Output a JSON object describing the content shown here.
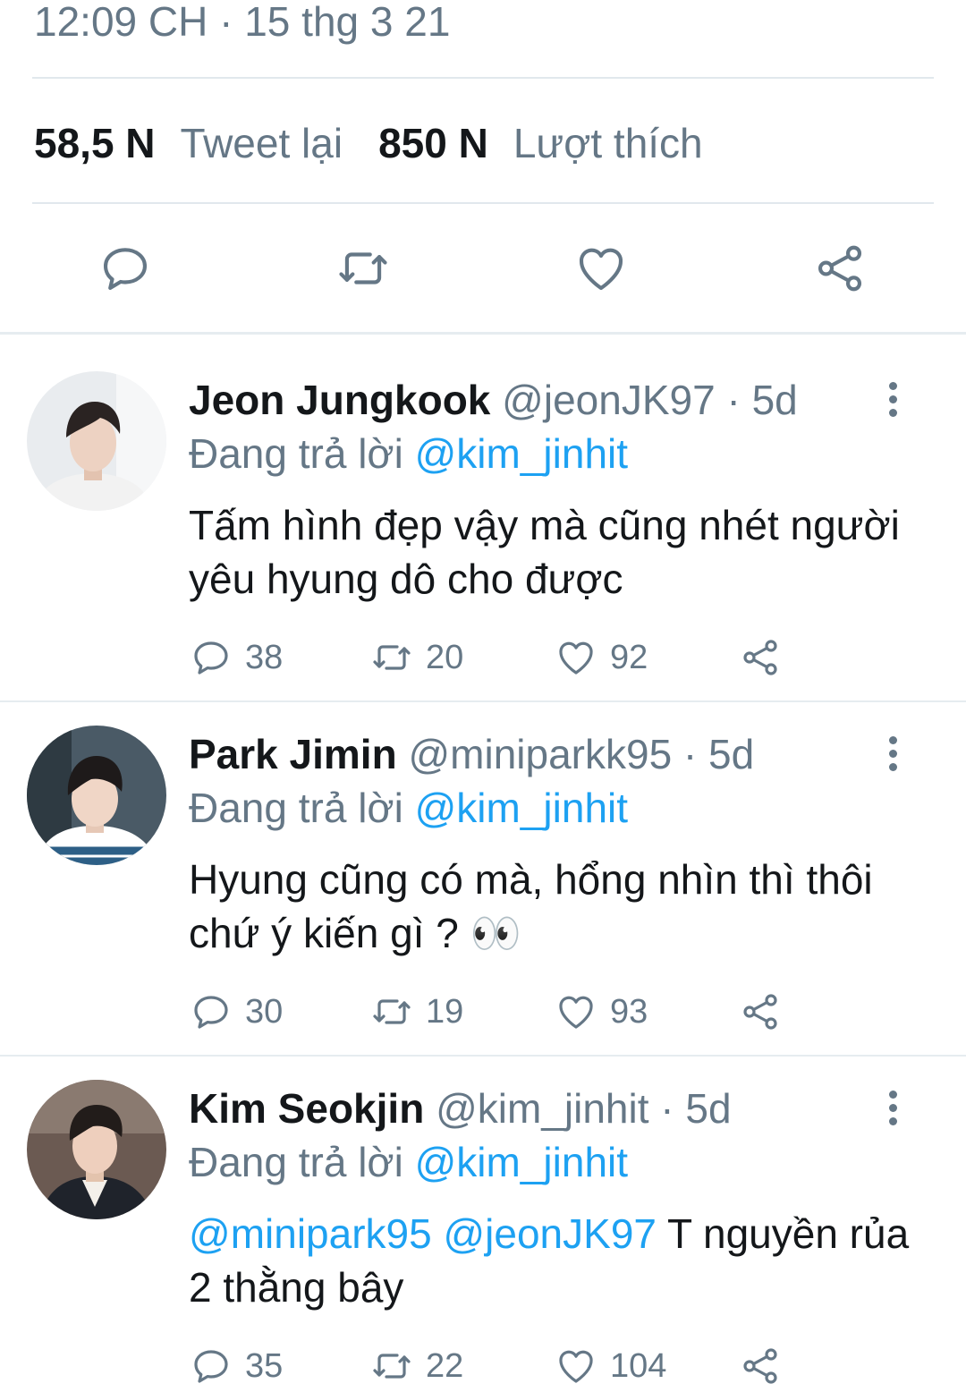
{
  "detail": {
    "timestamp": "12:09 CH · 15 thg 3 21",
    "retweets_count": "58,5 N",
    "retweets_label": "Tweet lại",
    "likes_count": "850 N",
    "likes_label": "Lượt thích"
  },
  "colors": {
    "accent": "#1da1f2",
    "secondary_text": "#657786",
    "divider": "#e1e8ed"
  },
  "replies": [
    {
      "name": "Jeon Jungkook",
      "handle": "@jeonJK97 · 5d",
      "replying_label": "Đang trả lời",
      "replying_to": "@kim_jinhit",
      "text_mentions": "",
      "text": "Tấm hình đẹp vậy mà cũng nhét người yêu hyung dô cho được",
      "reply_count": "38",
      "retweet_count": "20",
      "like_count": "92"
    },
    {
      "name": "Park Jimin",
      "handle": "@miniparkk95 · 5d",
      "replying_label": "Đang trả lời",
      "replying_to": "@kim_jinhit",
      "text_mentions": "",
      "text": "Hyung cũng có mà, hổng nhìn thì thôi chứ ý kiến gì ? 👀",
      "reply_count": "30",
      "retweet_count": "19",
      "like_count": "93"
    },
    {
      "name": "Kim Seokjin",
      "handle": "@kim_jinhit · 5d",
      "replying_label": "Đang trả lời",
      "replying_to": "@kim_jinhit",
      "text_mentions": "@minipark95 @jeonJK97 ",
      "text": "T nguyền rủa 2 thằng bây",
      "reply_count": "35",
      "retweet_count": "22",
      "like_count": "104"
    }
  ]
}
